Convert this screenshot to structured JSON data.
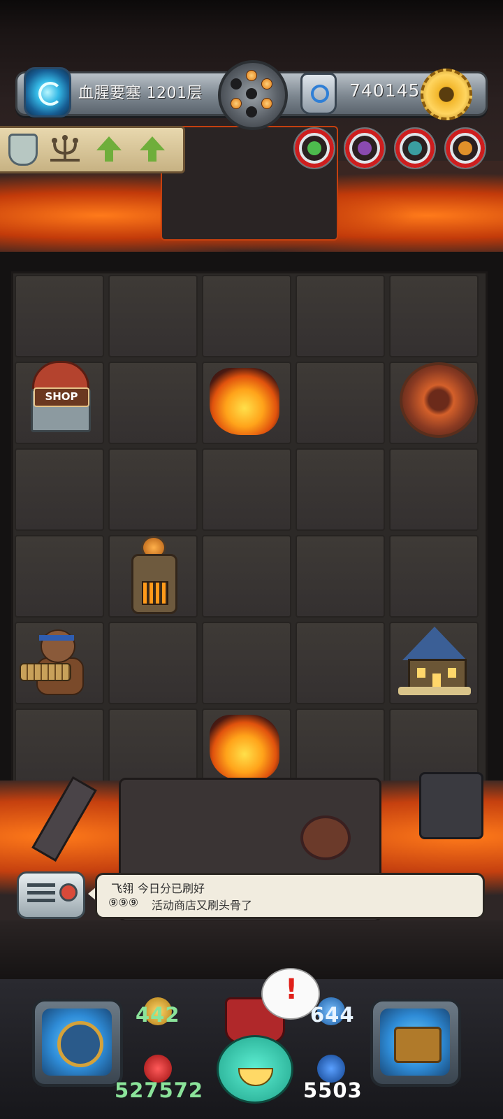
{
  "header": {
    "tower_title": "血腥要塞 1201层",
    "gold": "740145"
  },
  "board": {
    "shop_sign": "SHOP"
  },
  "chat": {
    "line1_name": "飞翎",
    "line1_msg": "今日分已刷好",
    "line2_name": "⑨⑨⑨",
    "line2_msg": "活动商店又刷头骨了"
  },
  "hud": {
    "attack": "442",
    "defense": "644",
    "hp": "527572",
    "mp": "5503",
    "alert": "!"
  },
  "colors": {
    "attack": "#8be39a",
    "defense": "#e8f4ff",
    "hp": "#8be39a",
    "mp": "#ffffff",
    "lava": "#ff7a1a"
  },
  "icons": [
    "portal-icon",
    "revolver-icon",
    "rune-icon",
    "gear-icon",
    "shield-icon",
    "candelabra-icon",
    "arrow-up-icon",
    "radio-icon",
    "compass-icon",
    "spellbook-icon"
  ]
}
